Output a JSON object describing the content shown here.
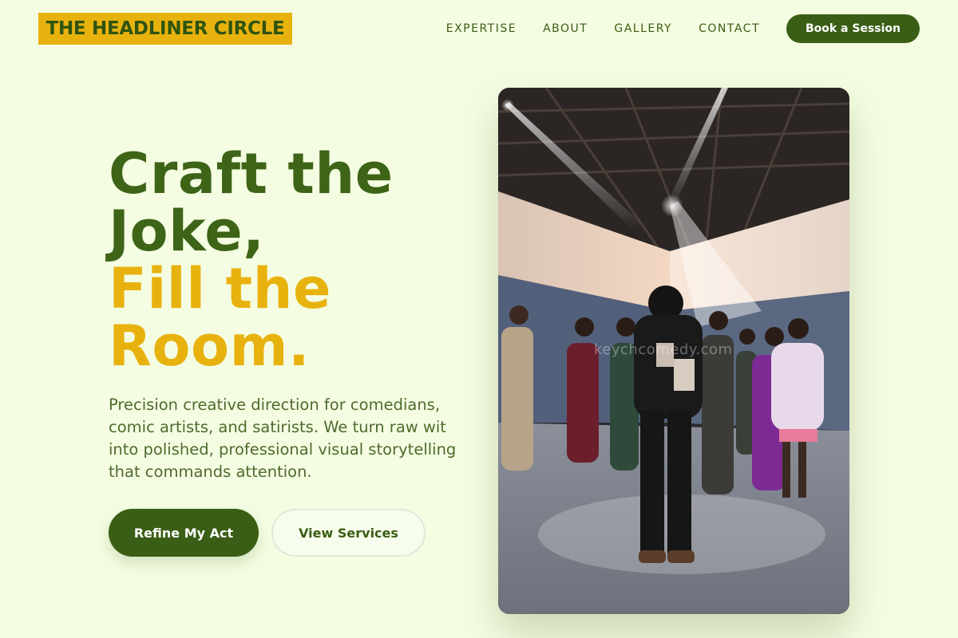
{
  "brand": {
    "logo_text": "THE HEADLINER CIRCLE"
  },
  "nav": {
    "links": [
      "EXPERTISE",
      "ABOUT",
      "GALLERY",
      "CONTACT"
    ],
    "cta": "Book a Session"
  },
  "hero": {
    "title_line1": "Craft the Joke,",
    "title_line2": "Fill the Room.",
    "description": "Precision creative direction for comedians, comic artists, and satirists. We turn raw wit into polished, professional visual storytelling that commands attention.",
    "primary_button": "Refine My Act",
    "secondary_button": "View Services",
    "image_watermark": "keychcomedy.com"
  },
  "colors": {
    "background": "#f4fde2",
    "primary_green": "#3a5e15",
    "accent_gold": "#e8b20e"
  }
}
